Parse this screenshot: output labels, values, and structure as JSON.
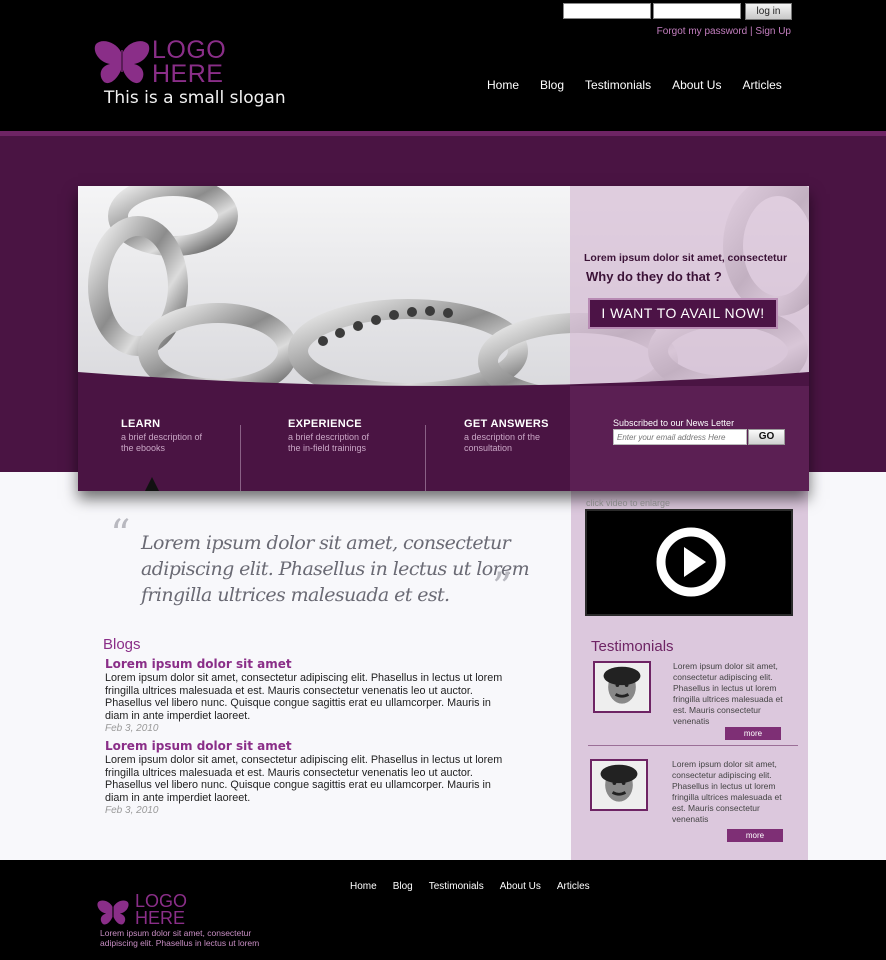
{
  "header": {
    "login": {
      "username_value": "",
      "password_value": "",
      "button_label": "log in",
      "forgot_label": "Forgot my password",
      "separator": "|",
      "signup_label": "Sign Up"
    },
    "logo": {
      "line1": "LOGO",
      "line2": "HERE",
      "icon": "butterfly-icon"
    },
    "slogan": "This is a small slogan",
    "nav": [
      "Home",
      "Blog",
      "Testimonials",
      "About Us",
      "Articles"
    ]
  },
  "hero": {
    "headline": "Lorem ipsum dolor sit amet, consectetur",
    "question": "Why do they do that ?",
    "cta_label": "I WANT TO AVAIL NOW!",
    "features": [
      {
        "title": "LEARN",
        "desc1": "a brief description of",
        "desc2": "the ebooks"
      },
      {
        "title": "EXPERIENCE",
        "desc1": "a brief description of",
        "desc2": "the in-field trainings"
      },
      {
        "title": "GET ANSWERS",
        "desc1": "a description of the",
        "desc2": "consultation"
      }
    ],
    "newsletter": {
      "label": "Subscribed to our News Letter",
      "placeholder": "Enter your email address Here",
      "button_label": "GO"
    }
  },
  "quote": {
    "text": "Lorem ipsum dolor sit amet, consectetur adipiscing elit. Phasellus in lectus ut lorem fringilla ultrices malesuada et est.",
    "open_mark": "“",
    "close_mark": "”"
  },
  "blogs": {
    "title": "Blogs",
    "posts": [
      {
        "title": "Lorem ipsum dolor sit amet",
        "body": "Lorem ipsum dolor sit amet, consectetur adipiscing elit. Phasellus in lectus ut lorem fringilla ultrices malesuada et est. Mauris consectetur venenatis leo ut auctor. Phasellus vel libero nunc. Quisque congue sagittis erat eu ullamcorper. Mauris in diam in ante imperdiet laoreet.",
        "date": "Feb 3, 2010"
      },
      {
        "title": "Lorem ipsum dolor sit amet",
        "body": "Lorem ipsum dolor sit amet, consectetur adipiscing elit. Phasellus in lectus ut lorem fringilla ultrices malesuada et est. Mauris consectetur venenatis leo ut auctor. Phasellus vel libero nunc. Quisque congue sagittis erat eu ullamcorper. Mauris in diam in ante imperdiet laoreet.",
        "date": "Feb 3, 2010"
      }
    ]
  },
  "sidebar": {
    "video_caption": "click video to enlarge",
    "play_icon": "play-icon",
    "testimonials_title": "Testimonials",
    "testimonials": [
      {
        "text": "Lorem ipsum dolor sit amet, consectetur adipiscing elit. Phasellus in lectus ut lorem fringilla ultrices malesuada et est. Mauris consectetur venenatis",
        "more_label": "more"
      },
      {
        "text": "Lorem ipsum dolor sit amet, consectetur adipiscing elit. Phasellus in lectus ut lorem fringilla ultrices malesuada et est. Mauris consectetur venenatis",
        "more_label": "more"
      }
    ]
  },
  "footer": {
    "nav": [
      "Home",
      "Blog",
      "Testimonials",
      "About Us",
      "Articles"
    ],
    "logo": {
      "line1": "LOGO",
      "line2": "HERE"
    },
    "text": "Lorem ipsum dolor sit amet, consectetur adipiscing elit. Phasellus in lectus ut lorem"
  },
  "colors": {
    "brand_purple": "#8a2e88",
    "band_purple": "#4a1443",
    "sidebar_bg": "#dcc8dd"
  }
}
